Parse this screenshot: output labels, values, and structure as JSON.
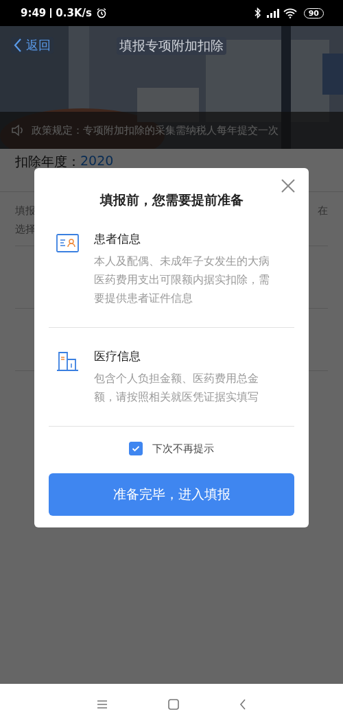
{
  "status_bar": {
    "time": "9:49",
    "speed": "0.3K/s",
    "battery": "90"
  },
  "header": {
    "back": "返回",
    "title": "填报专项附加扣除"
  },
  "notice": {
    "text": "政策规定：专项附加扣除的采集需纳税人每年提交一次"
  },
  "year_row": {
    "label": "扣除年度：",
    "value": "2020"
  },
  "intro": {
    "line_1": "填报",
    "line_2": "选择",
    "line_1_end": "在"
  },
  "dialog": {
    "title": "填报前，您需要提前准备",
    "sections": [
      {
        "kind": "patient",
        "title": "患者信息",
        "text": "本人及配偶、未成年子女发生的大病医药费用支出可限额内据实扣除，需要提供患者证件信息"
      },
      {
        "kind": "medical",
        "title": "医疗信息",
        "text": "包含个人负担金额、医药费用总金额，请按照相关就医凭证据实填写"
      }
    ],
    "dont_show_again": {
      "label": "下次不再提示",
      "checked": true
    },
    "confirm_button": "准备完毕，进入填报"
  }
}
